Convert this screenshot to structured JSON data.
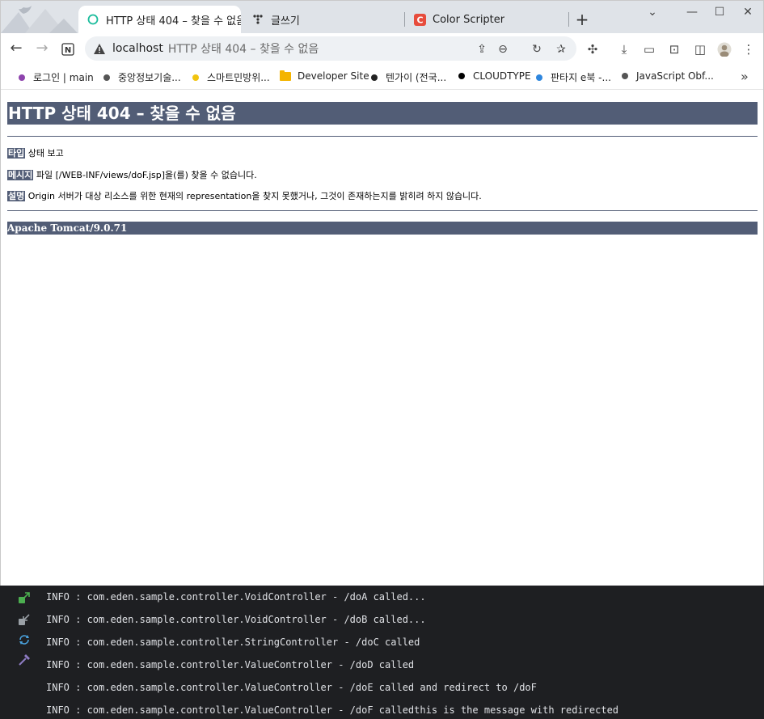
{
  "tabs": [
    {
      "label": "HTTP 상태 404 – 찾을 수 없음",
      "active": true
    },
    {
      "label": "글쓰기",
      "active": false
    },
    {
      "label": "Color Scripter",
      "active": false
    }
  ],
  "toolbar": {
    "host": "localhost",
    "title": "HTTP 상태 404 – 찾을 수 없음"
  },
  "bookmarks": [
    {
      "label": "로그인 | main",
      "color": "#8e44ad"
    },
    {
      "label": "중앙정보기술...",
      "color": "#555555"
    },
    {
      "label": "스마트민방위...",
      "color": "#f1c40f"
    },
    {
      "label": "Developer Site",
      "color": "folder"
    },
    {
      "label": "텐가이 (전국...",
      "color": "#222222"
    },
    {
      "label": "CLOUDTYPE",
      "color": "#000000"
    },
    {
      "label": "판타지 e북 -...",
      "color": "#2e86de"
    },
    {
      "label": "JavaScript Obf...",
      "color": "#555555"
    }
  ],
  "page": {
    "heading": "HTTP 상태 404 – 찾을 수 없음",
    "type_label": "타입",
    "type_value": "상태 보고",
    "message_label": "메시지",
    "message_value": "파일 [/WEB-INF/views/doF.jsp]을(를) 찾을 수 없습니다.",
    "desc_label": "설명",
    "desc_value": "Origin 서버가 대상 리소스를 위한 현재의 representation을 찾지 못했거나, 그것이 존재하는지를 밝히려 하지 않습니다.",
    "footer": "Apache Tomcat/9.0.71"
  },
  "console": {
    "lines": [
      "INFO : com.eden.sample.controller.VoidController - /doA called...",
      "INFO : com.eden.sample.controller.VoidController - /doB called...",
      "INFO : com.eden.sample.controller.StringController - /doC called",
      "INFO : com.eden.sample.controller.ValueController - /doD called",
      "INFO : com.eden.sample.controller.ValueController - /doE called and redirect to /doF",
      "INFO : com.eden.sample.controller.ValueController - /doF calledthis is the message with redirected"
    ],
    "icons": [
      "open-external-icon",
      "restart-icon",
      "refresh-icon",
      "build-icon"
    ]
  },
  "colors": {
    "tomcat_header": "#525d76",
    "console_bg": "#1e1f22",
    "tab_active_icon": "#1abc9c",
    "color_scripter_icon": "#e74c3c"
  }
}
